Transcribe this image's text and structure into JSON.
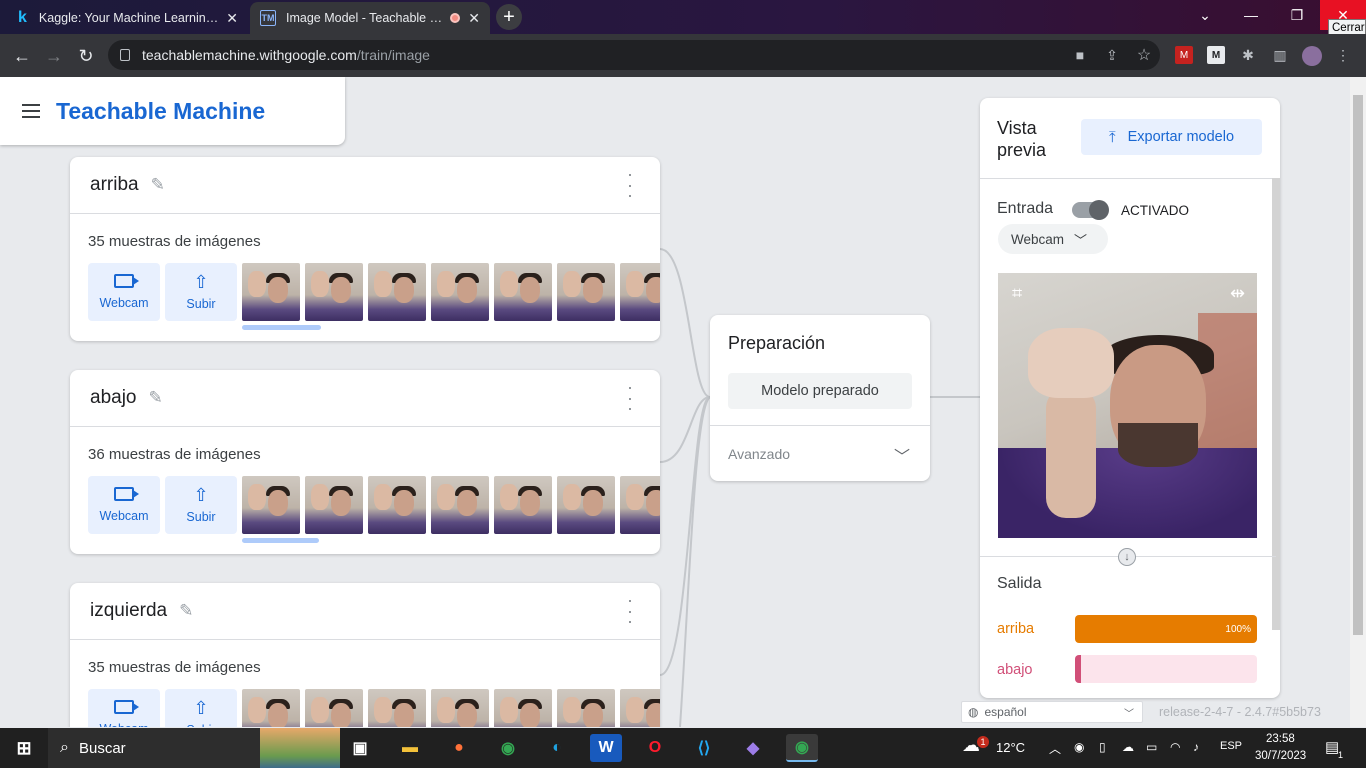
{
  "browser": {
    "tabs": [
      {
        "title": "Kaggle: Your Machine Learning and",
        "favicon": "k"
      },
      {
        "title": "Image Model - Teachable Machine",
        "favicon": "TM"
      }
    ],
    "close_tooltip": "Cerrar",
    "url_host": "teachablemachine.withgoogle.com",
    "url_path": "/train/image"
  },
  "brand": {
    "title": "Teachable Machine"
  },
  "classes": [
    {
      "name": "arriba",
      "count": "35 muestras de imágenes"
    },
    {
      "name": "abajo",
      "count": "36 muestras de imágenes"
    },
    {
      "name": "izquierda",
      "count": "35 muestras de imágenes"
    }
  ],
  "source_buttons": {
    "webcam": "Webcam",
    "upload": "Subir"
  },
  "training": {
    "title": "Preparación",
    "button": "Modelo preparado",
    "advanced": "Avanzado"
  },
  "preview": {
    "title": "Vista previa",
    "export": "Exportar modelo",
    "input_label": "Entrada",
    "toggle_state": "ACTIVADO",
    "toggle_on": true,
    "source": "Webcam",
    "output_label": "Salida",
    "outputs": [
      {
        "label": "arriba",
        "percent": 100,
        "percent_text": "100%",
        "color": "#e67c00",
        "track": "#fdecd9"
      },
      {
        "label": "abajo",
        "percent": 0,
        "percent_text": "",
        "color": "#d14f78",
        "track": "#fce4ec"
      }
    ]
  },
  "footer": {
    "language": "español",
    "release": "release-2-4-7 - 2.4.7#5b5b73"
  },
  "taskbar": {
    "search_placeholder": "Buscar",
    "weather_temp": "12°C",
    "weather_badge": "1",
    "lang": "ESP",
    "time": "23:58",
    "date": "30/7/2023",
    "notif_count": "1"
  },
  "colors": {
    "brand_blue": "#1967d2",
    "accent_light": "#e8f0fe",
    "close_red": "#e81123"
  }
}
